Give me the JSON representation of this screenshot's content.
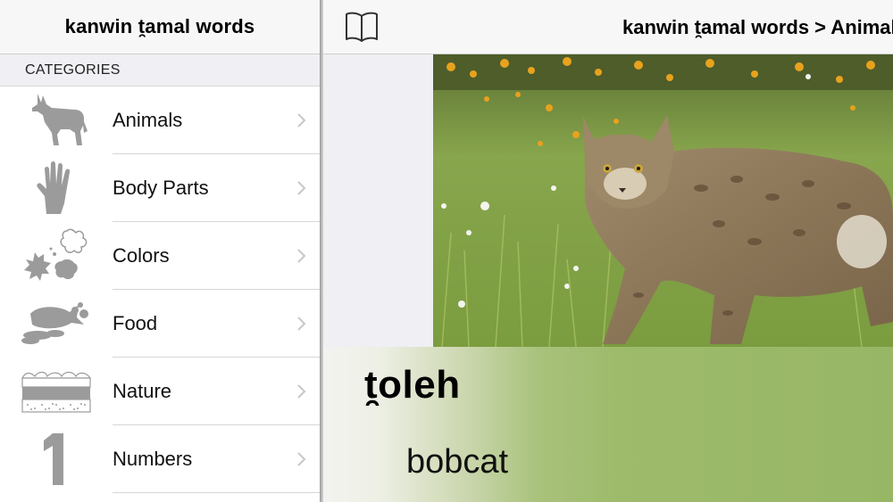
{
  "sidebar": {
    "title": "kanwin t̯amal words",
    "section_header": "CATEGORIES",
    "items": [
      {
        "label": "Animals",
        "icon": "coyote-icon"
      },
      {
        "label": "Body Parts",
        "icon": "hand-icon"
      },
      {
        "label": "Colors",
        "icon": "paint-splash-icon"
      },
      {
        "label": "Food",
        "icon": "fish-food-icon"
      },
      {
        "label": "Nature",
        "icon": "landscape-layers-icon"
      },
      {
        "label": "Numbers",
        "icon": "number-one-icon"
      }
    ]
  },
  "main": {
    "title": "kanwin t̯amal words > Animals",
    "book_icon": "book-icon",
    "photo": "bobcat-photo",
    "word": "t̯oleh",
    "translation": "bobcat"
  },
  "colors": {
    "icon_gray": "#9b9b9b",
    "chevron_gray": "#c7c7cc",
    "panel_green": "#9dbb6b"
  }
}
